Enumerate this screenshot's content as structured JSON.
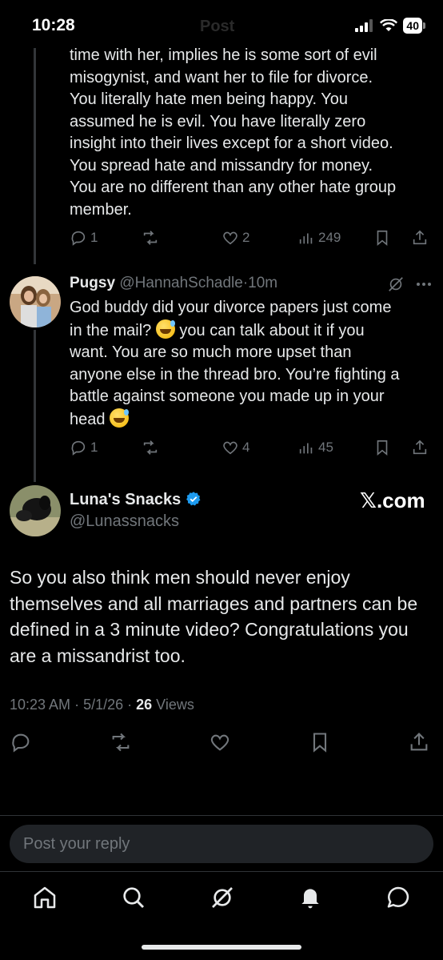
{
  "status": {
    "time": "10:28",
    "faded_title": "Post",
    "battery": "40"
  },
  "tweet1": {
    "lines": [
      "time with her, implies he is some sort of evil",
      "misogynist, and want her to file for divorce.",
      "You literally hate men being happy. You",
      "assumed he is evil. You have literally zero",
      "insight into their lives except for a short video.",
      "You spread hate and missandry for money.",
      "You are no different than any other hate group",
      "member."
    ],
    "replies": "1",
    "likes": "2",
    "views": "249"
  },
  "tweet2": {
    "name": "Pugsy",
    "handle": "@HannahSchadle",
    "sep": "·",
    "time": "10m",
    "lines": [
      "God buddy did your divorce papers just come",
      "in the mail?",
      "you can talk about it if you",
      "want. You are so much more upset than",
      "anyone else in the thread bro. You’re fighting a",
      "battle against someone you made up in your",
      "head"
    ],
    "replies": "1",
    "likes": "4",
    "views": "45"
  },
  "main_tweet": {
    "name": "Luna's Snacks",
    "handle": "@Lunassnacks",
    "watermark": "𝕏.com",
    "text": "So you also think men should never enjoy themselves and all marriages and partners can be defined in a 3 minute video? Congratulations you are a missandrist too.",
    "time": "10:23 AM",
    "date": "5/1/26",
    "views_count": "26",
    "views_label": "Views"
  },
  "reply": {
    "placeholder": "Post your reply"
  },
  "icons": {
    "reply": "reply-icon",
    "repost": "repost-icon",
    "like": "heart-icon",
    "views": "views-icon",
    "bookmark": "bookmark-icon",
    "share": "share-icon",
    "grok": "grok-icon",
    "more": "more-icon",
    "verified": "verified-badge-icon",
    "home": "home-icon",
    "search": "search-icon",
    "notifications": "bell-icon",
    "messages": "messages-icon"
  },
  "colors": {
    "background": "#000000",
    "text": "#e7e9ea",
    "muted": "#71767b",
    "verified": "#1d9bf0"
  }
}
